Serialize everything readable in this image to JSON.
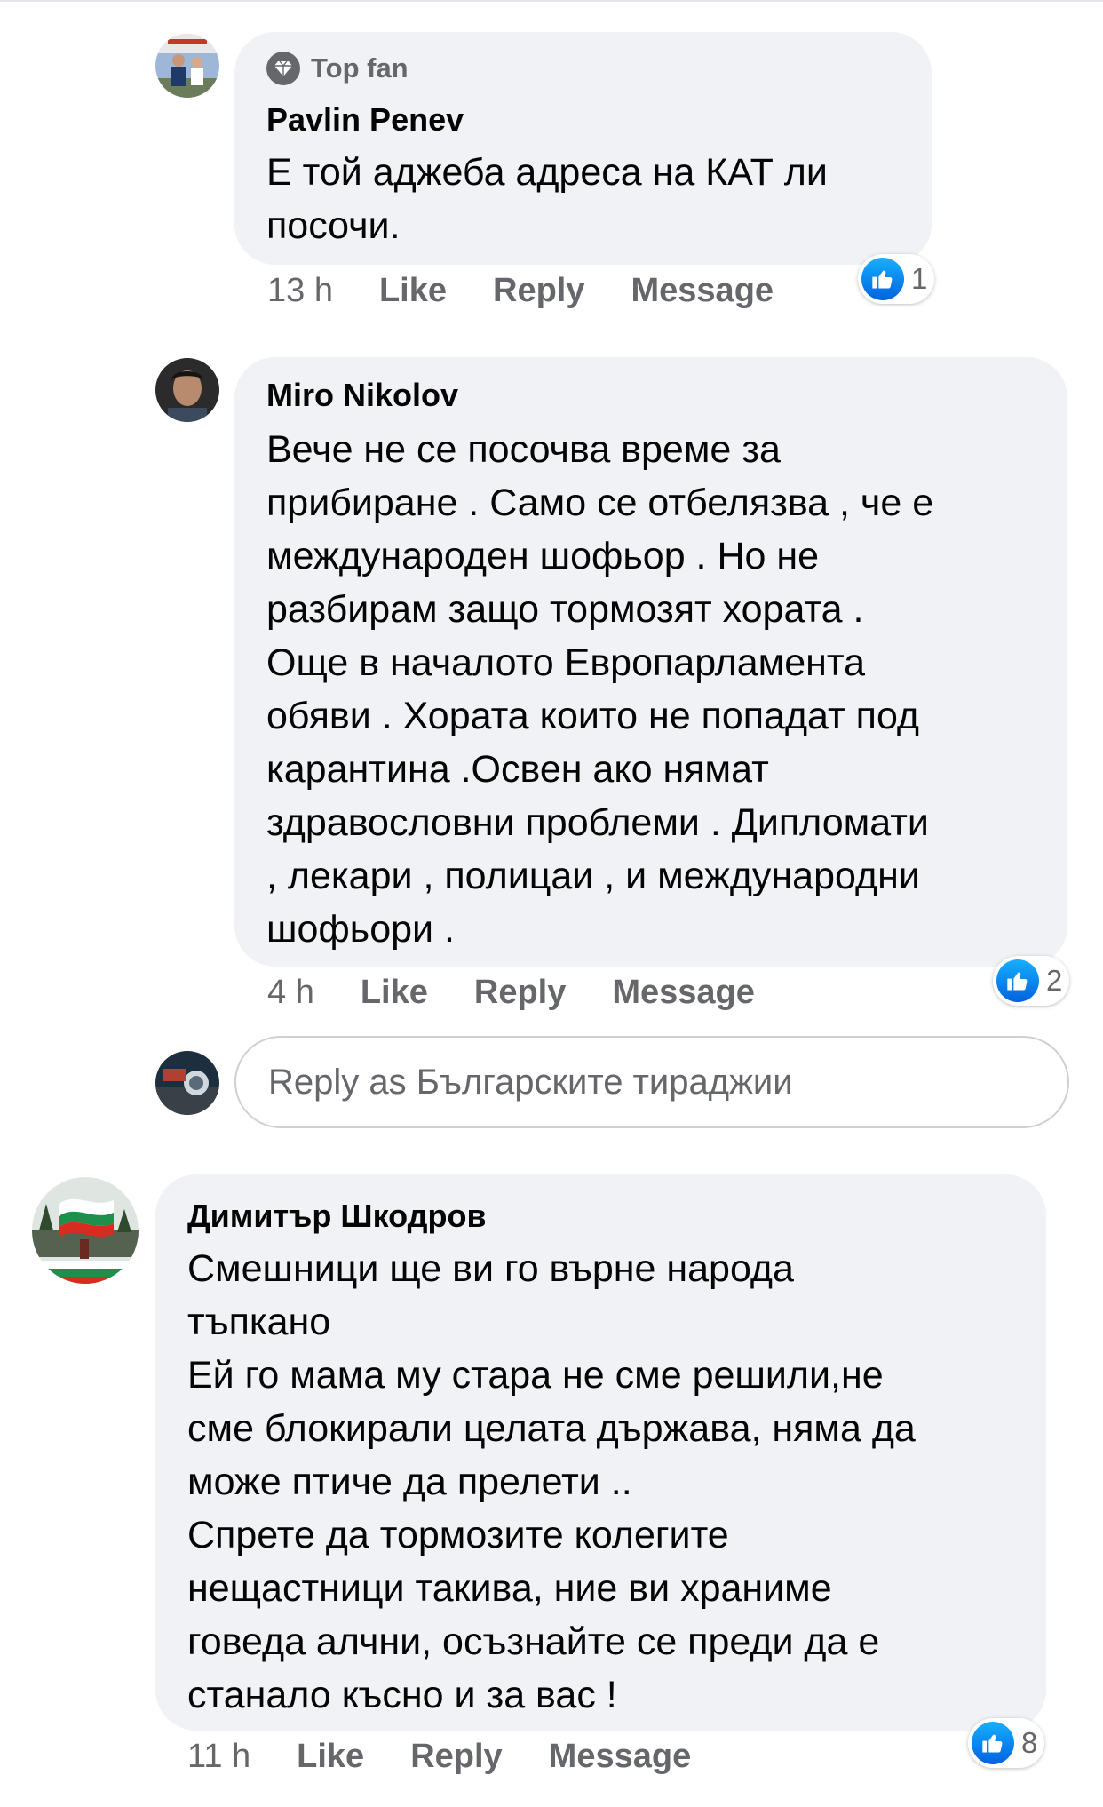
{
  "comments": [
    {
      "badge": "Top fan",
      "author": "Pavlin Penev",
      "text": "Е той аджеба адреса на КАТ ли\nпосочи.",
      "time": "13 h",
      "like_label": "Like",
      "reply_label": "Reply",
      "message_label": "Message",
      "reactions": "1"
    },
    {
      "author": "Miro Nikolov",
      "text": "Вече не се посочва време за\nприбиране . Само се отбелязва  , че е\nмеждународен шофьор . Но не\nразбирам защо тормозят хората .\nОще в началото Европарламента\nобяви . Хората които не попадат под\nкарантина .Освен ако нямат\nздравословни проблеми . Дипломати\n, лекари , полицаи , и международни\nшофьори .",
      "time": "4 h",
      "like_label": "Like",
      "reply_label": "Reply",
      "message_label": "Message",
      "reactions": "2"
    },
    {
      "author": "Димитър Шкодров",
      "text": "Смешници ще ви го върне народа\nтъпкано\nЕй го мама му стара не сме решили,не\nсме блокирали целата държава, няма да\nможе птиче да прелети ..\nСпрете да тормозите колегите\nнещастници такива, ние ви храниме\nговеда алчни, осъзнайте се преди да е\nстанало късно и за вас !",
      "time": "11 h",
      "like_label": "Like",
      "reply_label": "Reply",
      "message_label": "Message",
      "reactions": "8"
    }
  ],
  "reply_box": {
    "placeholder": "Reply as Българските тираджии"
  },
  "icons": {
    "badge": "diamond-icon",
    "reaction": "thumbs-up-icon"
  },
  "colors": {
    "bubble": "#f0f2f5",
    "secondary_text": "#65676b",
    "like_blue": "#1877f2"
  }
}
